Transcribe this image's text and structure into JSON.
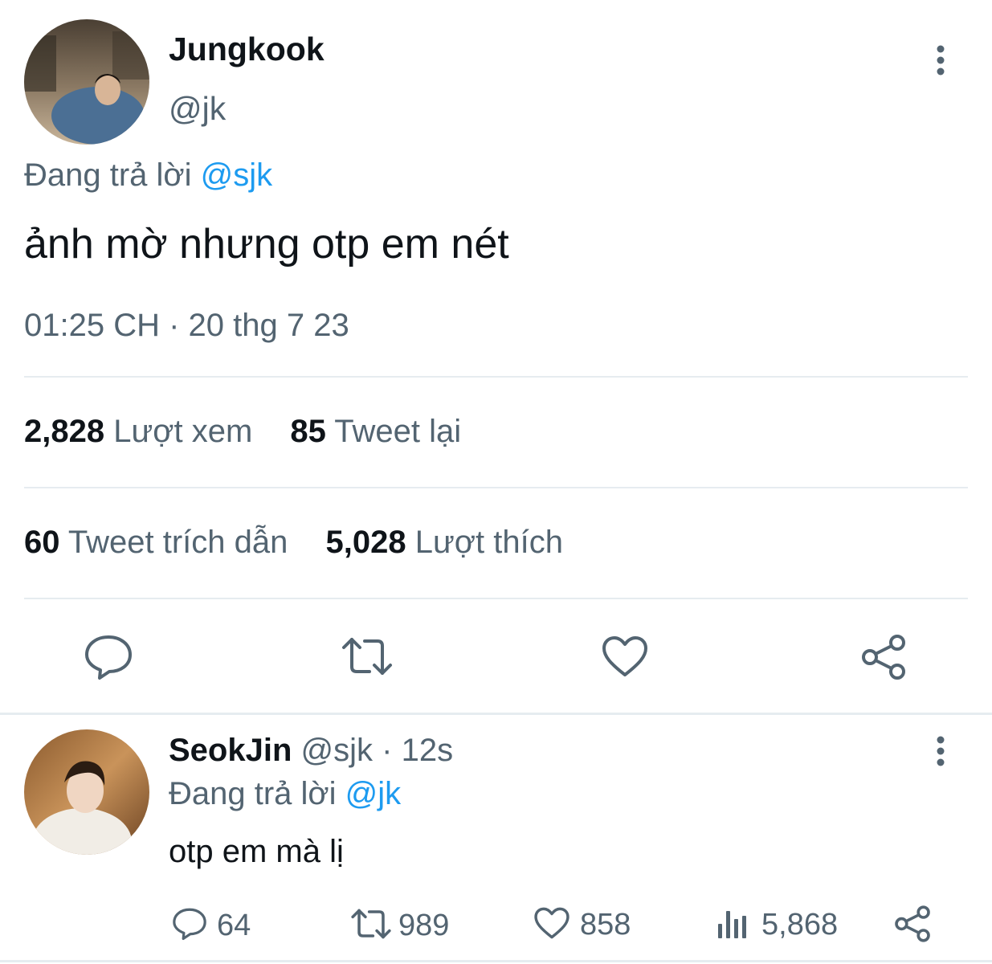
{
  "main_tweet": {
    "author_name": "Jungkook",
    "author_handle": "@jk",
    "reply_prefix": "Đang trả lời",
    "reply_to": "@sjk",
    "text": "ảnh mờ nhưng otp em nét",
    "timestamp": "01:25 CH · 20 thg 7 23",
    "stats": {
      "views_count": "2,828",
      "views_label": "Lượt xem",
      "retweets_count": "85",
      "retweets_label": "Tweet lại",
      "quotes_count": "60",
      "quotes_label": "Tweet trích dẫn",
      "likes_count": "5,028",
      "likes_label": "Lượt thích"
    },
    "actions": [
      "reply-icon",
      "retweet-icon",
      "like-icon",
      "share-icon"
    ]
  },
  "reply_tweet": {
    "author_name": "SeokJin",
    "author_handle": "@sjk",
    "time_ago": "· 12s",
    "reply_prefix": "Đang trả lời",
    "reply_to": "@jk",
    "text": "otp em mà lị",
    "replies": "64",
    "retweets": "989",
    "likes": "858",
    "views": "5,868"
  },
  "colors": {
    "accent": "#1d9bf0",
    "text": "#0f1419",
    "muted": "#536471",
    "divider": "#e6ecf0"
  }
}
